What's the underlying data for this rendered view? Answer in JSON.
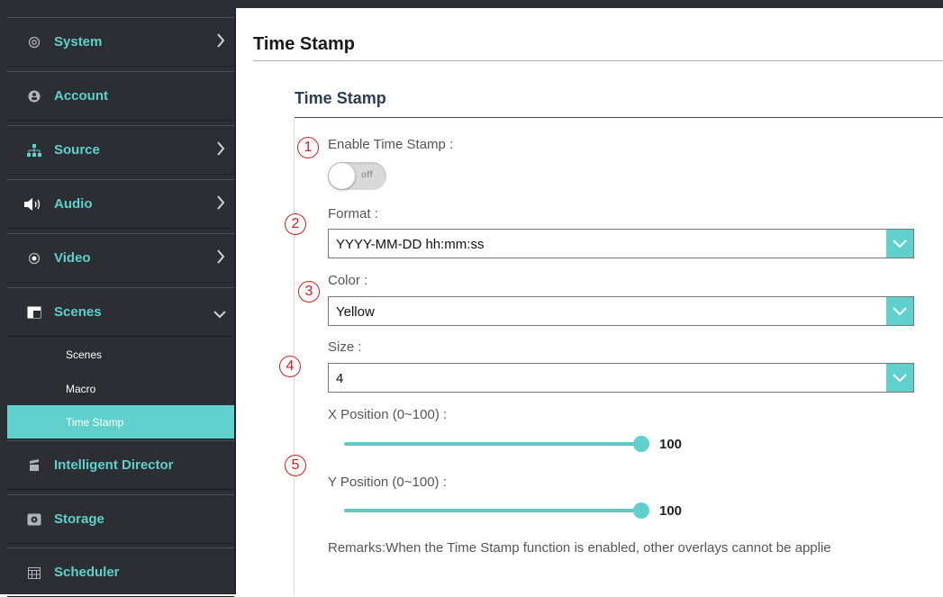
{
  "sidebar": {
    "items": [
      {
        "label": "System",
        "icon": "gear-icon",
        "has_chevron": true
      },
      {
        "label": "Account",
        "icon": "account-icon",
        "has_chevron": false
      },
      {
        "label": "Source",
        "icon": "sitemap-icon",
        "has_chevron": true
      },
      {
        "label": "Audio",
        "icon": "speaker-icon",
        "has_chevron": true
      },
      {
        "label": "Video",
        "icon": "video-dot-icon",
        "has_chevron": true
      },
      {
        "label": "Scenes",
        "icon": "scenes-icon",
        "has_chevron": true,
        "expanded": true
      },
      {
        "label": "Intelligent Director",
        "icon": "director-icon",
        "has_chevron": false
      },
      {
        "label": "Storage",
        "icon": "storage-icon",
        "has_chevron": false
      },
      {
        "label": "Scheduler",
        "icon": "calendar-icon",
        "has_chevron": false
      }
    ],
    "sub_items": [
      {
        "label": "Scenes"
      },
      {
        "label": "Macro"
      },
      {
        "label": "Time Stamp",
        "active": true
      }
    ]
  },
  "main": {
    "title": "Time Stamp",
    "section_title": "Time Stamp",
    "markers": [
      "1",
      "2",
      "3",
      "4",
      "5"
    ],
    "enable": {
      "label": "Enable Time Stamp :",
      "toggle_text": "off"
    },
    "format": {
      "label": "Format :",
      "value": "YYYY-MM-DD hh:mm:ss"
    },
    "color": {
      "label": "Color :",
      "value": "Yellow"
    },
    "size": {
      "label": "Size :",
      "value": "4"
    },
    "x_position": {
      "label": "X Position (0~100) :",
      "value": "100"
    },
    "y_position": {
      "label": "Y Position (0~100) :",
      "value": "100"
    },
    "remarks": "Remarks:When the Time Stamp function is enabled, other overlays cannot be applie"
  },
  "colors": {
    "accent": "#5fd0cb",
    "sidebar_bg": "#2b2f33",
    "marker": "#d21f1f"
  }
}
